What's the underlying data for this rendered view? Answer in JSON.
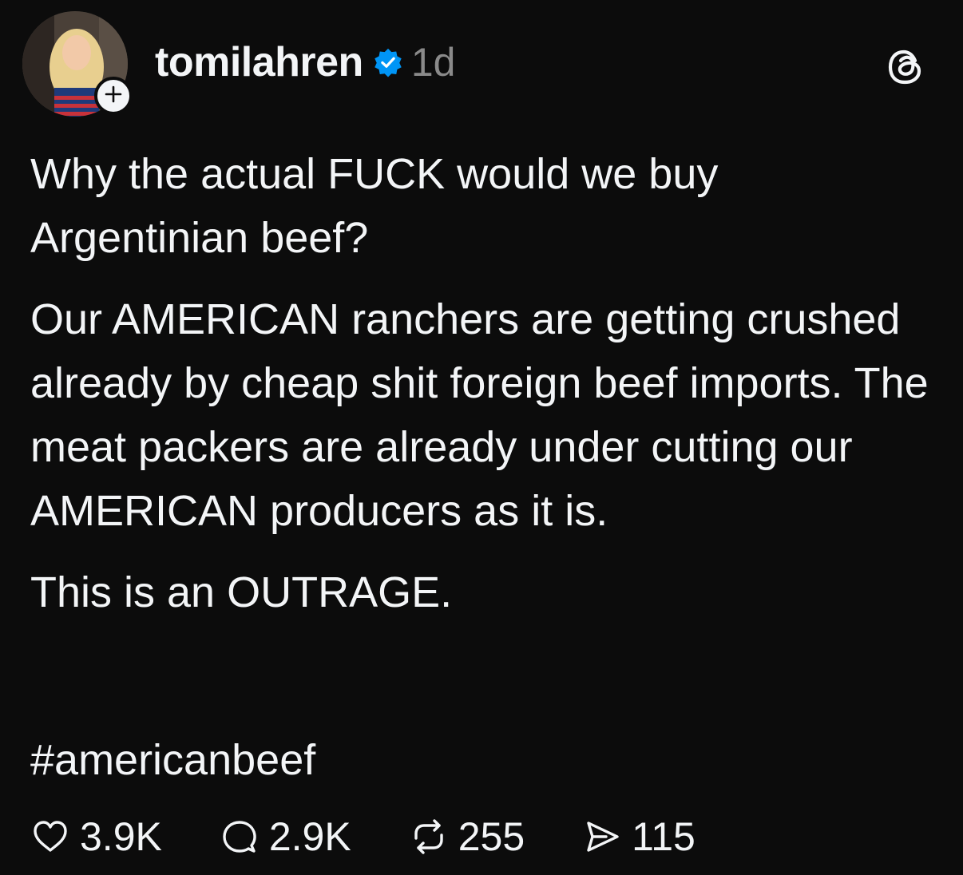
{
  "post": {
    "username": "tomilahren",
    "verified": true,
    "time": "1d",
    "paragraphs": [
      "Why the actual FUCK would we buy Argentinian beef?",
      "Our AMERICAN ranchers are getting crushed already by cheap shit foreign beef imports. The meat packers are already under cutting our AMERICAN producers as it is.",
      "This is an OUTRAGE."
    ],
    "hashtag": "#americanbeef"
  },
  "actions": {
    "likes": "3.9K",
    "replies": "2.9K",
    "reposts": "255",
    "shares": "115"
  },
  "icons": {
    "follow": "plus-icon",
    "verified": "verified-badge-icon",
    "app": "threads-logo-icon",
    "like": "heart-icon",
    "reply": "comment-icon",
    "repost": "repost-icon",
    "share": "send-icon"
  },
  "colors": {
    "background": "#0c0c0c",
    "text": "#f3f5f7",
    "muted": "#8a8a8a",
    "verified": "#0095f6"
  }
}
